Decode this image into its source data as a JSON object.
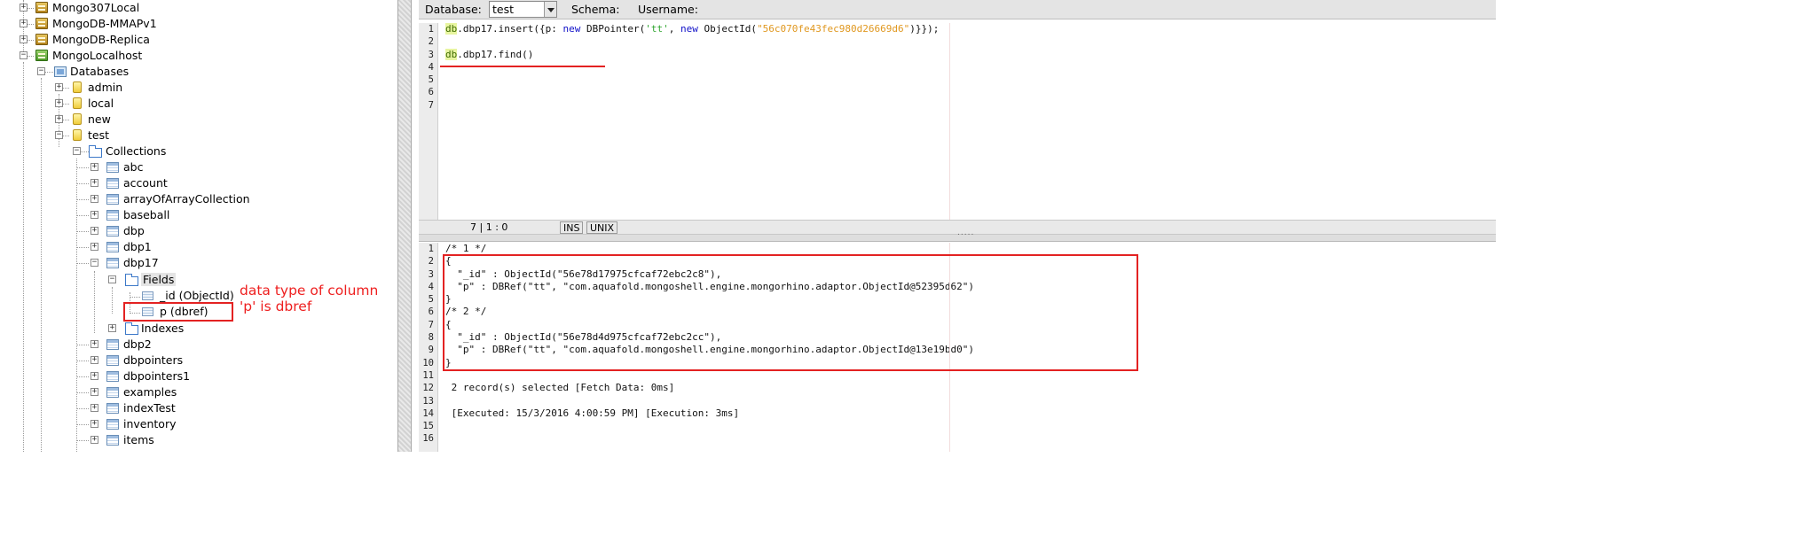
{
  "tree": {
    "servers": [
      {
        "label": "Mongo307Local"
      },
      {
        "label": "MongoDB-MMAPv1"
      },
      {
        "label": "MongoDB-Replica"
      },
      {
        "label": "MongoLocalhost"
      }
    ],
    "databases_label": "Databases",
    "dbs": [
      {
        "label": "admin"
      },
      {
        "label": "local"
      },
      {
        "label": "new"
      },
      {
        "label": "test"
      }
    ],
    "collections_label": "Collections",
    "collections_before": [
      {
        "label": "abc"
      },
      {
        "label": "account"
      },
      {
        "label": "arrayOfArrayCollection"
      },
      {
        "label": "baseball"
      },
      {
        "label": "dbp"
      },
      {
        "label": "dbp1"
      },
      {
        "label": "dbp17"
      }
    ],
    "fields_label": "Fields",
    "fields": [
      {
        "label": "_id (ObjectId)"
      },
      {
        "label": "p (dbref)"
      }
    ],
    "indexes_label": "Indexes",
    "collections_after": [
      {
        "label": "dbp2"
      },
      {
        "label": "dbpointers"
      },
      {
        "label": "dbpointers1"
      },
      {
        "label": "examples"
      },
      {
        "label": "indexTest"
      },
      {
        "label": "inventory"
      },
      {
        "label": "items"
      }
    ]
  },
  "toolbar": {
    "database_label": "Database:",
    "database_value": "test",
    "schema_label": "Schema:",
    "username_label": "Username:"
  },
  "editor": {
    "line_numbers": [
      "1",
      "2",
      "3",
      "4",
      "5",
      "6",
      "7"
    ],
    "line1": {
      "db": "db",
      "a": ".dbp17.insert({p: ",
      "new1": "new",
      "b": " DBPointer(",
      "s1": "'tt'",
      "c": ", ",
      "new2": "new",
      "d": " ObjectId(",
      "s2": "\"56c070fe43fec980d26669d6\"",
      "e": ")}});"
    },
    "line3": {
      "db": "db",
      "rest": ".dbp17.find()"
    }
  },
  "status": {
    "position": "7 | 1 : 0",
    "mode": "INS",
    "eol": "UNIX"
  },
  "results": {
    "line_numbers": [
      "1",
      "2",
      "3",
      "4",
      "5",
      "6",
      "7",
      "8",
      "9",
      "10",
      "11",
      "12",
      "13",
      "14",
      "15",
      "16"
    ],
    "lines": [
      "/* 1 */",
      "{",
      "  \"_id\" : ObjectId(\"56e78d17975cfcaf72ebc2c8\"),",
      "  \"p\" : DBRef(\"tt\", \"com.aquafold.mongoshell.engine.mongorhino.adaptor.ObjectId@52395d62\")",
      "}",
      "/* 2 */",
      "{",
      "  \"_id\" : ObjectId(\"56e78d4d975cfcaf72ebc2cc\"),",
      "  \"p\" : DBRef(\"tt\", \"com.aquafold.mongoshell.engine.mongorhino.adaptor.ObjectId@13e19bd0\")",
      "}",
      "",
      " 2 record(s) selected [Fetch Data: 0ms]",
      "",
      " [Executed: 15/3/2016 4:00:59 PM] [Execution: 3ms]",
      "",
      ""
    ]
  },
  "annotation": {
    "note": "data type of column\n'p' is dbref"
  },
  "colors": {
    "annotation_red": "#e32222",
    "keyword_new": "#1010c8",
    "string_green": "#2fa52f",
    "hex_orange": "#e09820"
  }
}
